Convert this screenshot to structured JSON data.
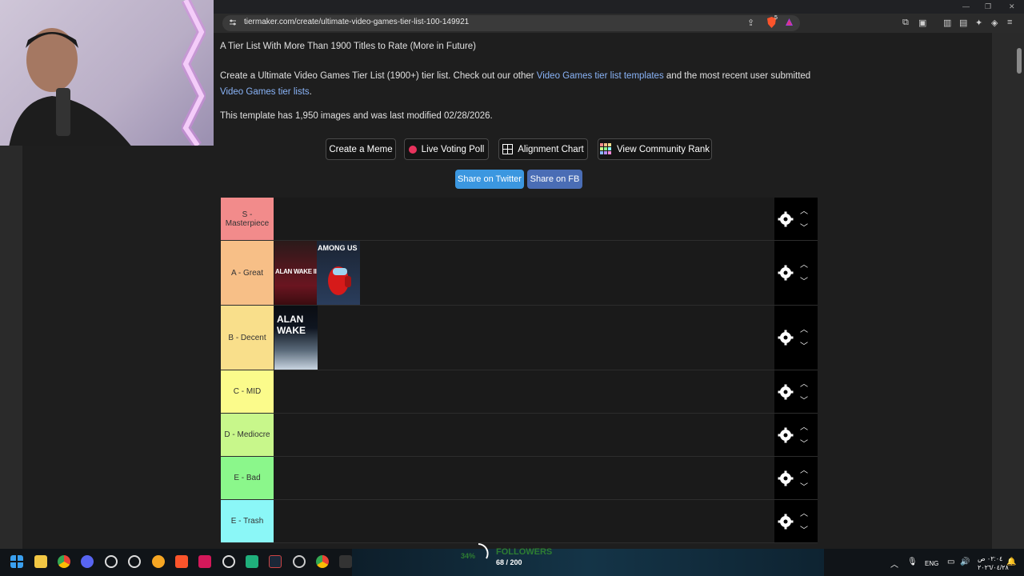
{
  "browser": {
    "url": "tiermaker.com/create/ultimate-video-games-tier-list-100-149921",
    "shield_badge": "5"
  },
  "page": {
    "subtitle": "A Tier List With More Than 1900 Titles to Rate (More in Future)",
    "desc_part1": "Create a Ultimate Video Games Tier List (1900+) tier list. Check out our other ",
    "desc_link1": "Video Games tier list templates",
    "desc_part2": " and the most recent user submitted ",
    "desc_link2": "Video Games tier lists",
    "desc_part3": ".",
    "info": "This template has 1,950 images and was last modified 02/28/2026."
  },
  "buttons": {
    "create_meme": "Create a Meme",
    "live_voting": "Live Voting Poll",
    "alignment_chart": "Alignment Chart",
    "community_rank": "View Community Rank",
    "share_twitter": "Share on Twitter",
    "share_fb": "Share on FB"
  },
  "tiers": [
    {
      "label": "S - Masterpiece",
      "color": "#f28b8b"
    },
    {
      "label": "A - Great",
      "color": "#f7bf87"
    },
    {
      "label": "B - Decent",
      "color": "#f9df8b"
    },
    {
      "label": "C - MID",
      "color": "#fbfb8b"
    },
    {
      "label": "D - Mediocre",
      "color": "#c8f78b"
    },
    {
      "label": "E - Bad",
      "color": "#8bf78b"
    },
    {
      "label": "E - Trash",
      "color": "#8bf7f7"
    }
  ],
  "games": {
    "alan_wake_2": "ALAN WAKE II",
    "among_us": "AMONG US",
    "alan_wake_1": "ALAN WAKE"
  },
  "taskbar": {
    "followers_label": "FOLLOWERS",
    "followers_count": "68 / 200",
    "followers_pct": "34%",
    "lang": "ENG",
    "time": "٠٢:٠٤ ص",
    "date": "٢٠٢٦/٠٤/٢٨"
  }
}
